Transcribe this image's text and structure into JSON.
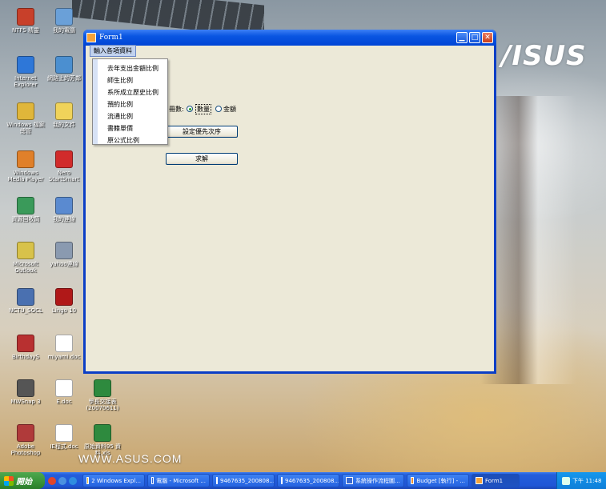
{
  "wallpaper": {
    "brand": "/ISUS",
    "url": "WWW.ASUS.COM"
  },
  "desktop_icons": [
    {
      "label": "NTFS 精靈",
      "color": "#c8402a"
    },
    {
      "label": "我的電腦",
      "color": "#6aa0d8"
    },
    {
      "label": "Internet Explorer",
      "color": "#2e77d8"
    },
    {
      "label": "網路上的芳鄰",
      "color": "#4b8fd0"
    },
    {
      "label": "Windows 檔案總管",
      "color": "#e0b63a"
    },
    {
      "label": "我的文件",
      "color": "#f0d35a"
    },
    {
      "label": "Windows Media Player",
      "color": "#e0802a"
    },
    {
      "label": "Nero StartSmart",
      "color": "#d12b2b"
    },
    {
      "label": "資源回收筒",
      "color": "#3a9a5a"
    },
    {
      "label": "我的連線",
      "color": "#5a8ad0"
    },
    {
      "label": "Microsoft Outlook",
      "color": "#d8c24a"
    },
    {
      "label": "yahoo連線",
      "color": "#8a9ab0"
    },
    {
      "label": "NCTU_SOCL",
      "color": "#4a70b0"
    },
    {
      "label": "Lingo 10",
      "color": "#b01818"
    },
    {
      "label": "BirthdayS",
      "color": "#b83030"
    },
    {
      "label": "miyami.doc",
      "color": "#ffffff"
    },
    {
      "label": "MWSnap 3",
      "color": "#555555"
    },
    {
      "label": "E.doc",
      "color": "#ffffff"
    },
    {
      "label": "學長交接表 (20070611)",
      "color": "#2e8a3e"
    },
    {
      "label": "Adobe Photoshop",
      "color": "#b03a3a"
    },
    {
      "label": "IE程式.doc",
      "color": "#ffffff"
    },
    {
      "label": "原始資料95 資料.xls",
      "color": "#2e8a3e"
    }
  ],
  "window": {
    "title": "Form1",
    "menu": "輸入各項資料",
    "dropdown_items": [
      "去年支出金額比例",
      "師生比例",
      "系所成立歷史比例",
      "預約比例",
      "流通比例",
      "書籍單價",
      "原公式比例"
    ],
    "count_label": "冊數:",
    "radios": [
      {
        "label": "數量",
        "checked": true
      },
      {
        "label": "金額",
        "checked": false
      }
    ],
    "btn_priority": "設定優先次序",
    "btn_solve": "求解"
  },
  "taskbar": {
    "start": "開始",
    "tasks": [
      {
        "label": "2 Windows Expl...",
        "color": "#f0c040"
      },
      {
        "label": "電腦 - Microsoft ...",
        "color": "#3a6ad0"
      },
      {
        "label": "9467635_200808...",
        "color": "#ffffff"
      },
      {
        "label": "9467635_200808...",
        "color": "#ffffff"
      },
      {
        "label": "系統操作流程圖...",
        "color": "#3a6ad0"
      },
      {
        "label": "Budget [執行] - ...",
        "color": "#f09030"
      },
      {
        "label": "Form1",
        "color": "#f6a33a"
      }
    ],
    "clock": "下午 11:48"
  }
}
